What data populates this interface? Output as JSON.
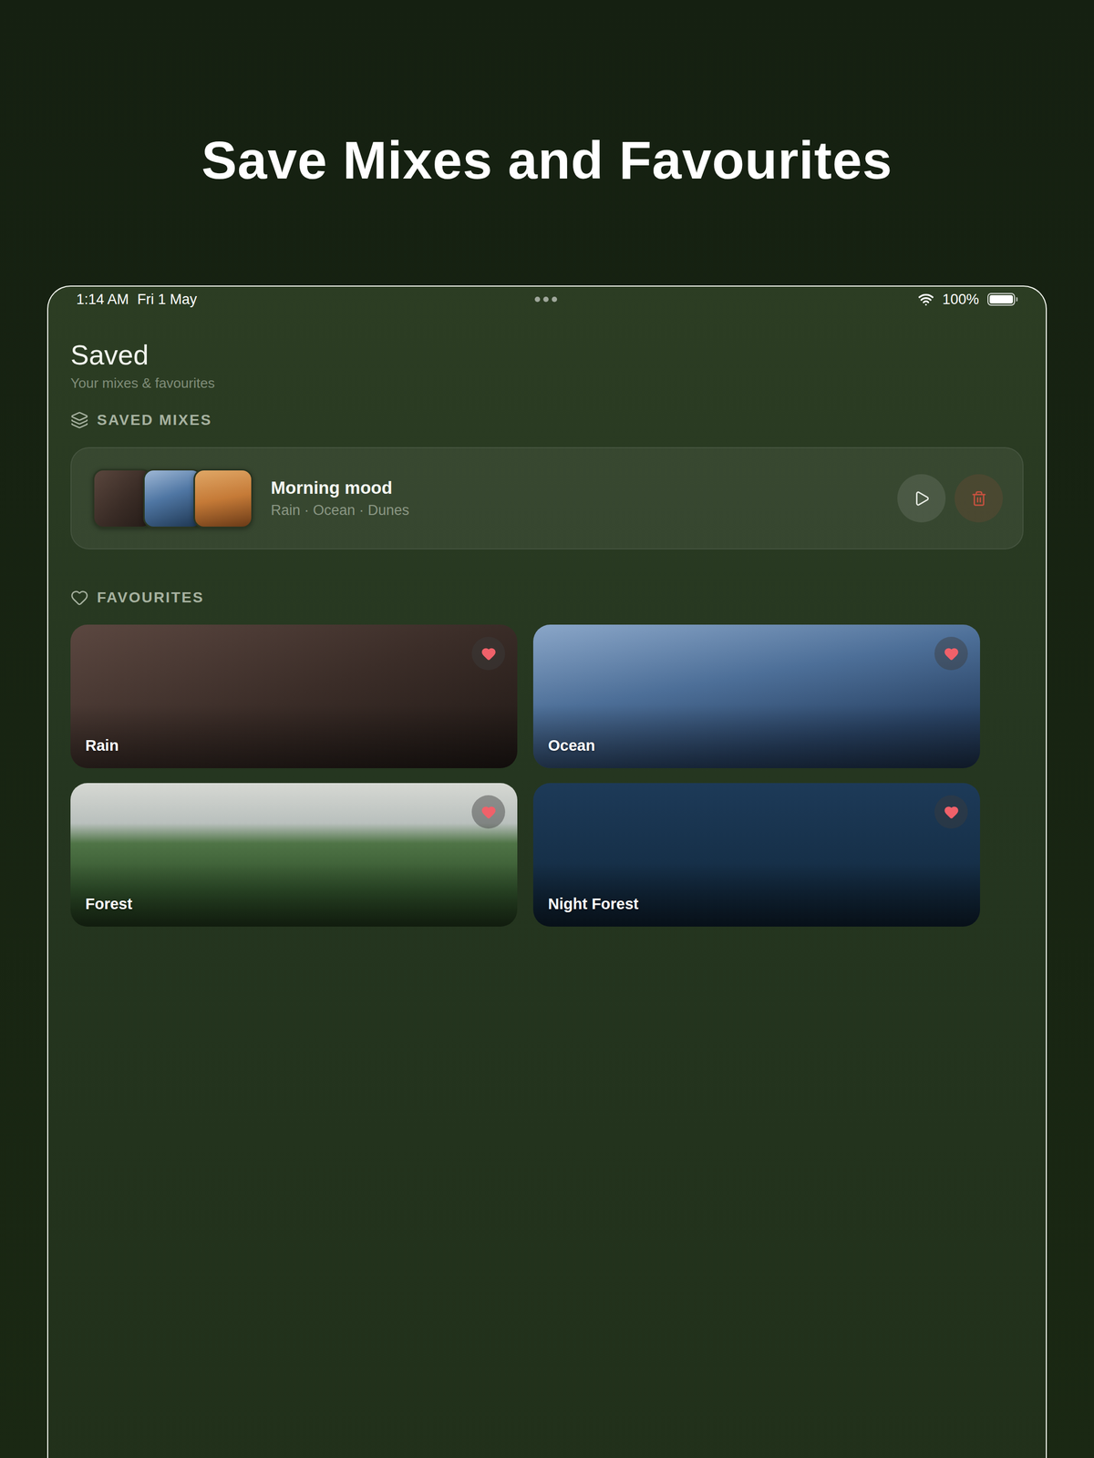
{
  "hero": {
    "title": "Save Mixes and Favourites"
  },
  "status_bar": {
    "time": "1:14 AM",
    "date": "Fri 1 May",
    "battery": "100%",
    "battery_level": 1
  },
  "screen": {
    "title": "Saved",
    "subtitle": "Your mixes & favourites"
  },
  "sections": {
    "mixes": "SAVED MIXES",
    "favourites": "FAVOURITES"
  },
  "mixes": [
    {
      "name": "Morning mood",
      "sounds": "Rain · Ocean · Dunes"
    }
  ],
  "favourites": [
    {
      "label": "Rain",
      "favourite": true
    },
    {
      "label": "Ocean",
      "favourite": true
    },
    {
      "label": "Forest",
      "favourite": true
    },
    {
      "label": "Night Forest",
      "favourite": true
    }
  ]
}
